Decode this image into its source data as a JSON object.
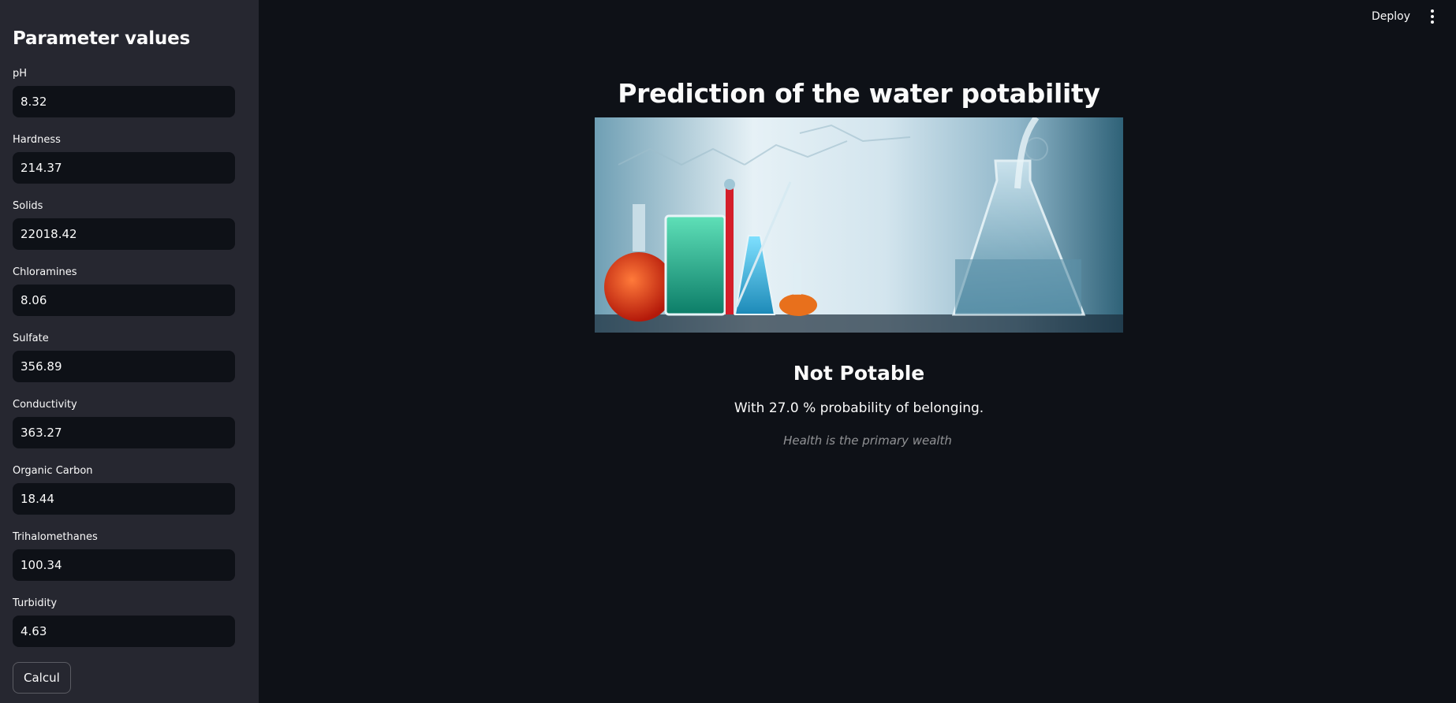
{
  "sidebar": {
    "title": "Parameter values",
    "fields": [
      {
        "label": "pH",
        "value": "8.32"
      },
      {
        "label": "Hardness",
        "value": "214.37"
      },
      {
        "label": "Solids",
        "value": "22018.42"
      },
      {
        "label": "Chloramines",
        "value": "8.06"
      },
      {
        "label": "Sulfate",
        "value": "356.89"
      },
      {
        "label": "Conductivity",
        "value": "363.27"
      },
      {
        "label": "Organic Carbon",
        "value": "18.44"
      },
      {
        "label": "Trihalomethanes",
        "value": "100.34"
      },
      {
        "label": "Turbidity",
        "value": "4.63"
      }
    ],
    "button_label": "Calcul"
  },
  "header": {
    "deploy_label": "Deploy",
    "menu_icon": "vertical-dots-icon"
  },
  "main": {
    "title": "Prediction of the water potability",
    "image_icon": "lab-glassware-image",
    "result_title": "Not Potable",
    "result_text": "With 27.0 % probability of belonging.",
    "caption": "Health is the primary wealth"
  },
  "colors": {
    "background": "#0e1117",
    "sidebar": "#262730",
    "text": "#fafafa"
  }
}
